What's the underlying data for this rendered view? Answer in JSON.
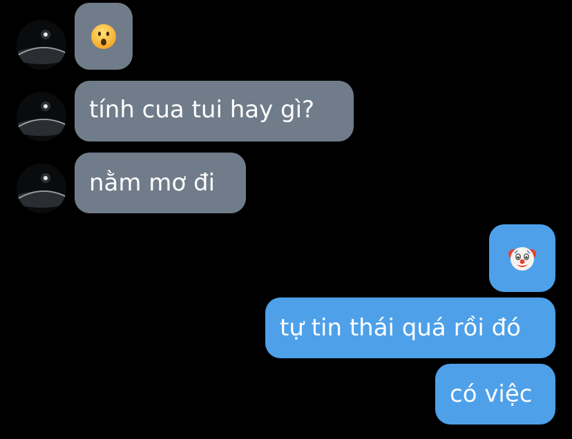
{
  "conversation": {
    "incoming": [
      {
        "kind": "emoji",
        "icon": "surprised-face-emoji"
      },
      {
        "kind": "text",
        "text": "tính cua tui hay gì?"
      },
      {
        "kind": "text",
        "text": "nằm mơ đi"
      }
    ],
    "outgoing": [
      {
        "kind": "emoji",
        "icon": "clown-face-emoji"
      },
      {
        "kind": "text",
        "text": "tự tin thái quá rồi đó"
      },
      {
        "kind": "text",
        "text": "có việc"
      }
    ]
  },
  "colors": {
    "background": "#000000",
    "incoming_bubble": "#707c89",
    "outgoing_bubble": "#4ea0e9",
    "text": "#ffffff"
  }
}
